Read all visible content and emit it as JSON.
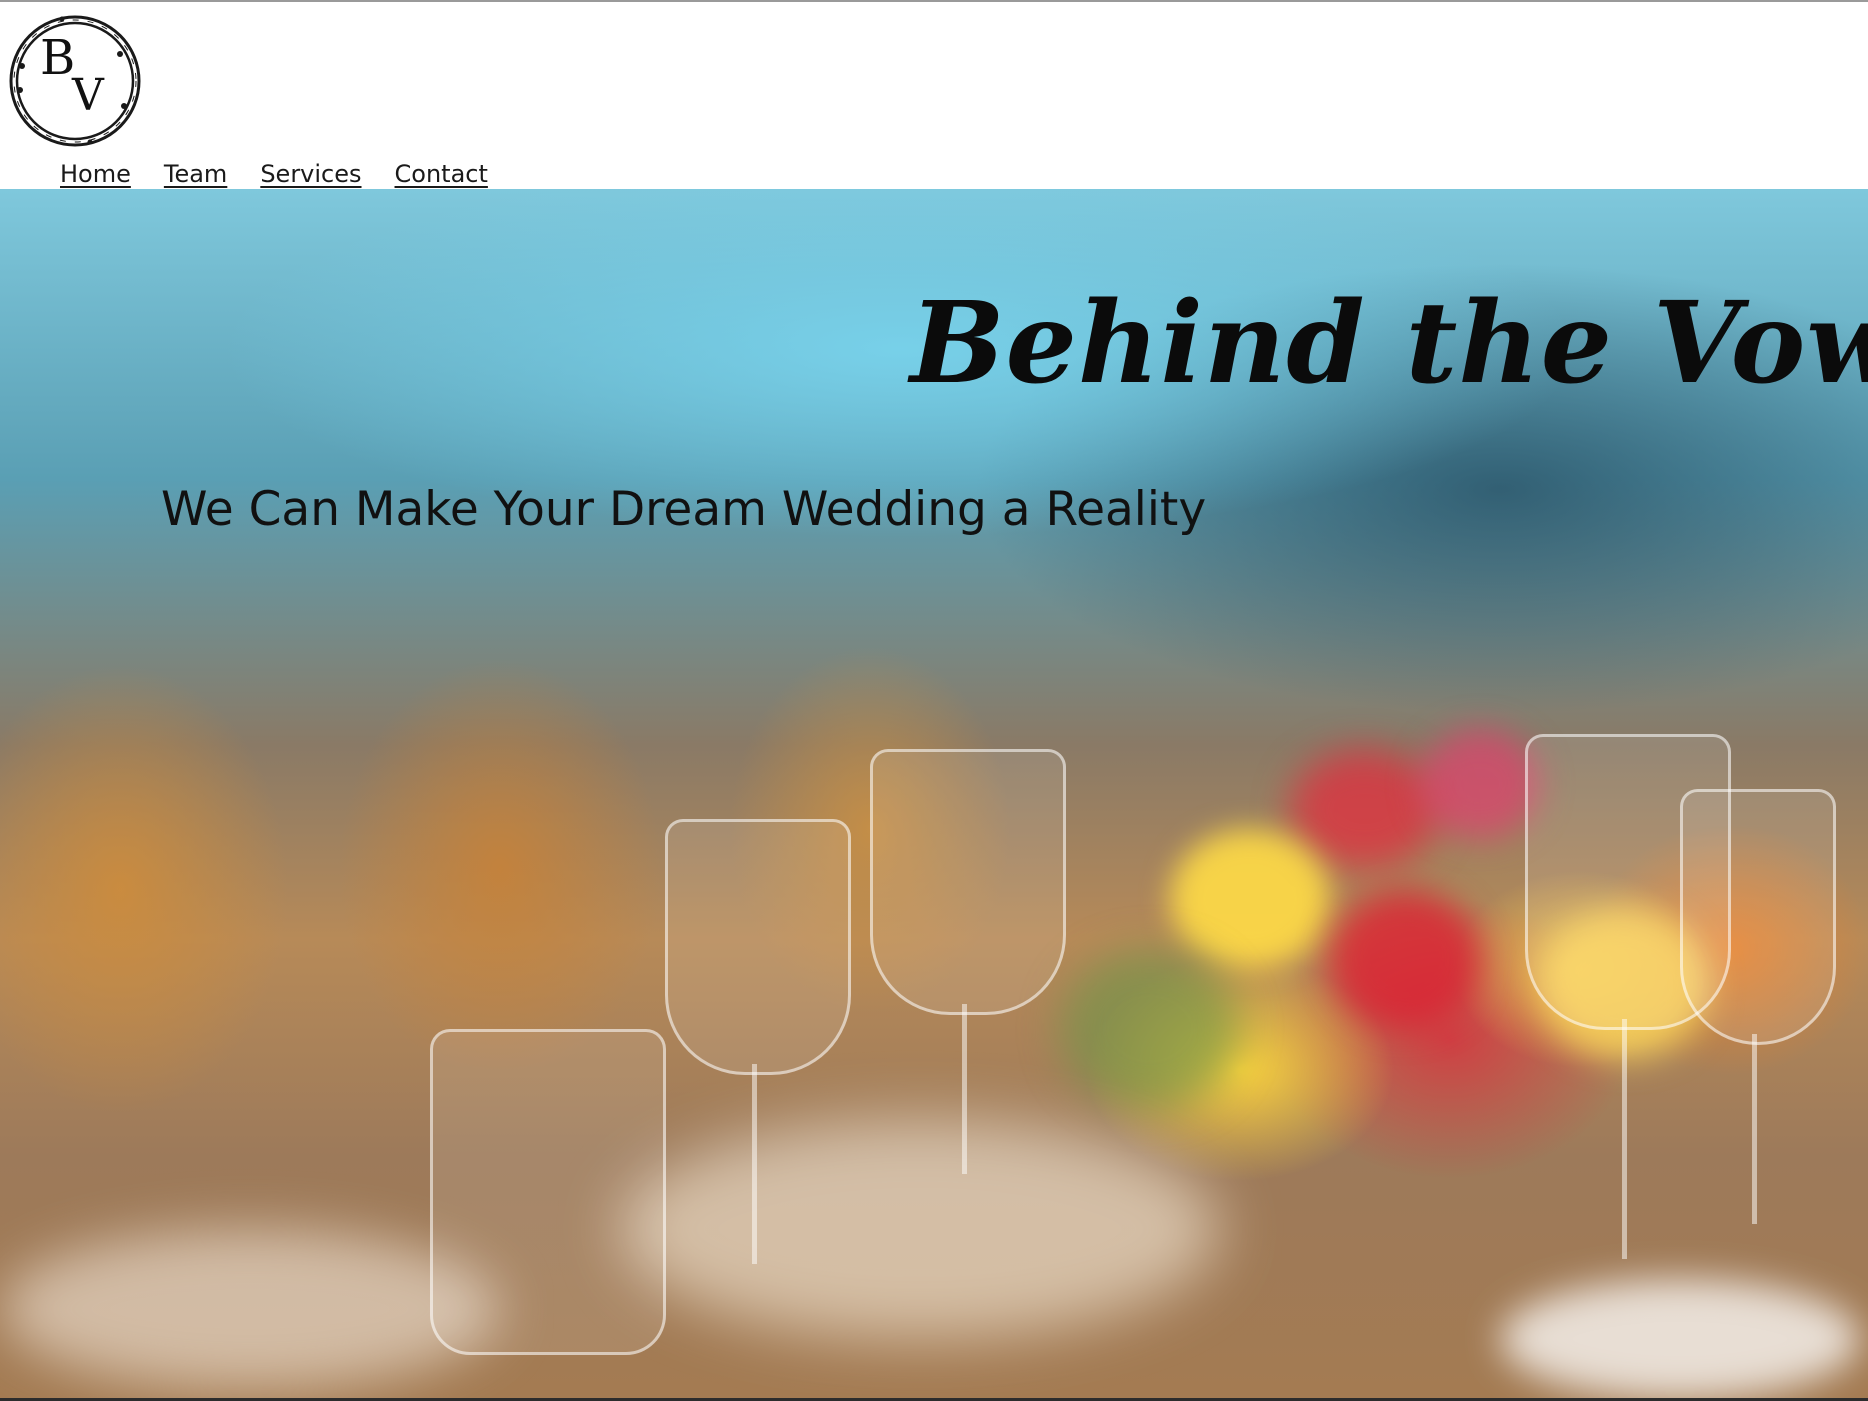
{
  "logo": {
    "letters": [
      "B",
      "V"
    ]
  },
  "nav": {
    "items": [
      {
        "label": "Home"
      },
      {
        "label": "Team"
      },
      {
        "label": "Services"
      },
      {
        "label": "Contact"
      }
    ]
  },
  "hero": {
    "title": "Behind the Vows",
    "subtitle": "We Can Make Your Dream Wedding a Reality"
  },
  "colors": {
    "text": "#111111",
    "background": "#ffffff"
  }
}
